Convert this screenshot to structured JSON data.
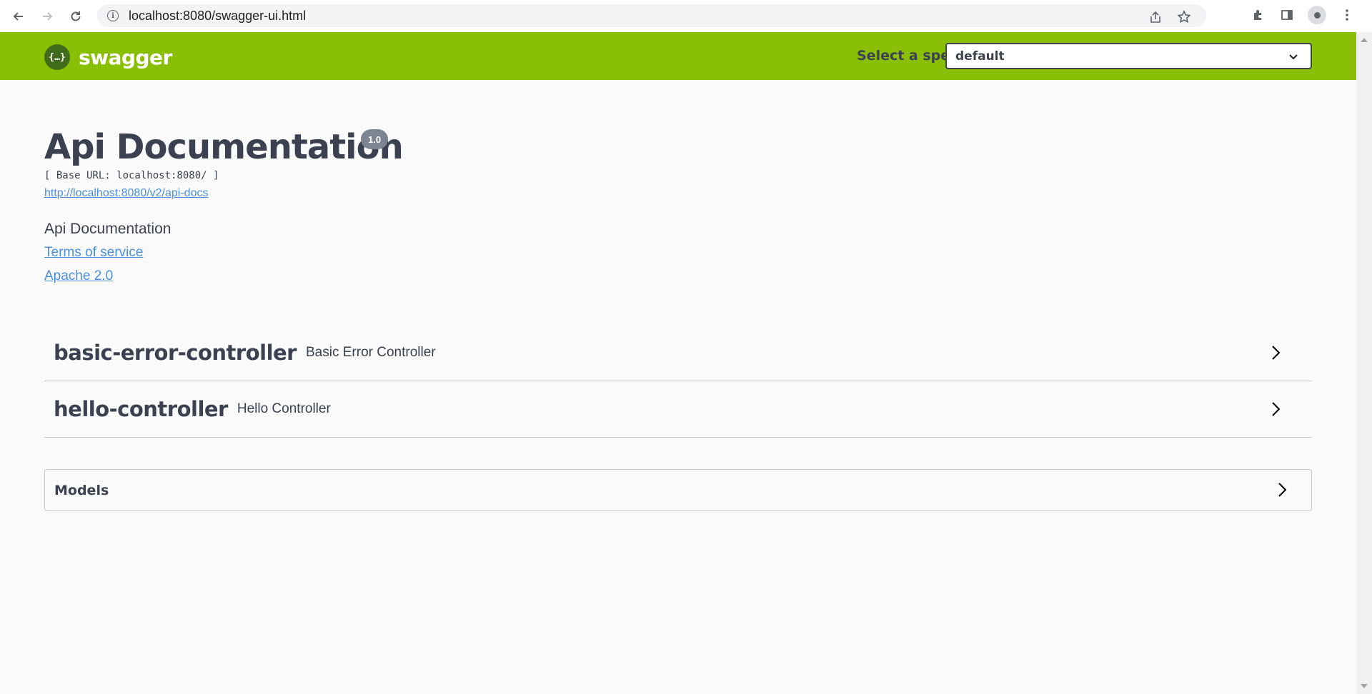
{
  "browser": {
    "url": "localhost:8080/swagger-ui.html"
  },
  "topbar": {
    "logo_symbol": "{…}",
    "logo_text": "swagger",
    "spec_label": "Select a spec",
    "spec_selected": "default"
  },
  "info": {
    "title": "Api Documentation",
    "version": "1.0",
    "base_url": "[ Base URL: localhost:8080/ ]",
    "api_docs_link": "http://localhost:8080/v2/api-docs",
    "description": "Api Documentation",
    "terms_link": "Terms of service",
    "license_link": "Apache 2.0"
  },
  "tags": [
    {
      "name": "basic-error-controller",
      "description": "Basic Error Controller"
    },
    {
      "name": "hello-controller",
      "description": "Hello Controller"
    }
  ],
  "models": {
    "title": "Models"
  },
  "colors": {
    "topbar": "#89bf04",
    "text": "#3b4151",
    "link": "#4990e2",
    "version_badge": "#7d8492"
  }
}
